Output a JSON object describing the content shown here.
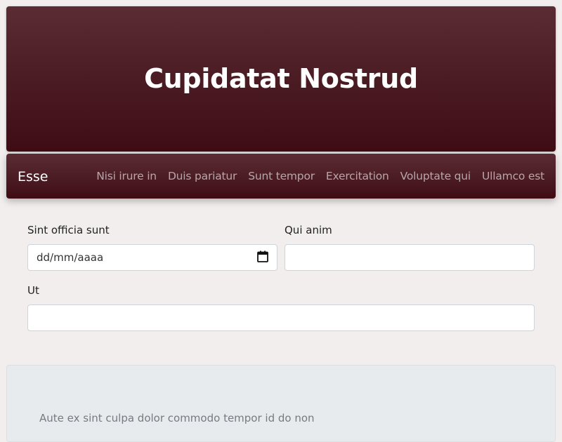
{
  "hero": {
    "title": "Cupidatat Nostrud"
  },
  "navbar": {
    "brand": "Esse",
    "links": [
      "Nisi irure in",
      "Duis pariatur",
      "Sunt tempor",
      "Exercitation",
      "Voluptate qui",
      "Ullamco est"
    ]
  },
  "form": {
    "field1": {
      "label": "Sint officia sunt",
      "placeholder": "dd/mm/aaaa"
    },
    "field2": {
      "label": "Qui anim",
      "value": ""
    },
    "field3": {
      "label": "Ut",
      "value": ""
    }
  },
  "card": {
    "text": "Aute ex sint culpa dolor commodo tempor id do non"
  },
  "colors": {
    "primary": "#4a1a22",
    "background": "#f1eeed",
    "card": "#e8ebed"
  }
}
